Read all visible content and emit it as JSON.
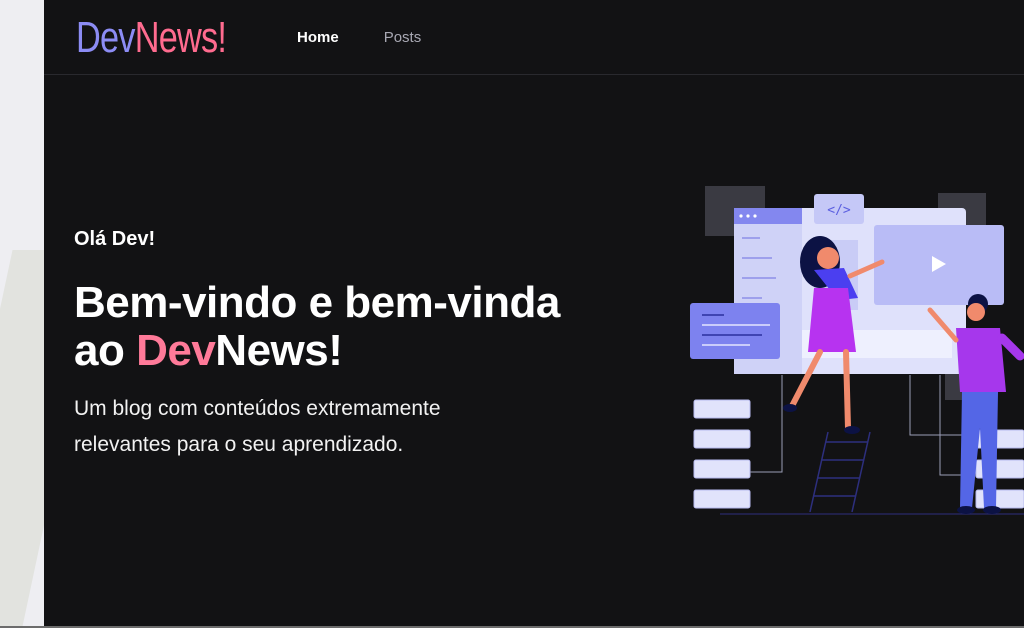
{
  "header": {
    "logo": {
      "part1": "Dev",
      "part2": "News!"
    },
    "nav": [
      {
        "label": "Home",
        "active": true
      },
      {
        "label": "Posts",
        "active": false
      }
    ]
  },
  "hero": {
    "greeting": "Olá Dev!",
    "headline_line1": "Bem-vindo e bem-vinda",
    "headline_line2_prefix": "ao ",
    "headline_accent": "Dev",
    "headline_suffix": "News!",
    "subtitle_line1": "Um blog com conteúdos extremamente",
    "subtitle_line2": "relevantes para o seu aprendizado."
  },
  "colors": {
    "background": "#121214",
    "logo_dev": "#8c8cf4",
    "logo_news": "#ff6b8f",
    "accent": "#ff7a99",
    "nav_inactive": "#a8a8b3"
  },
  "illustration": {
    "icon": "developers-illustration",
    "code_icon": "code-icon",
    "play_icon": "play-icon"
  }
}
